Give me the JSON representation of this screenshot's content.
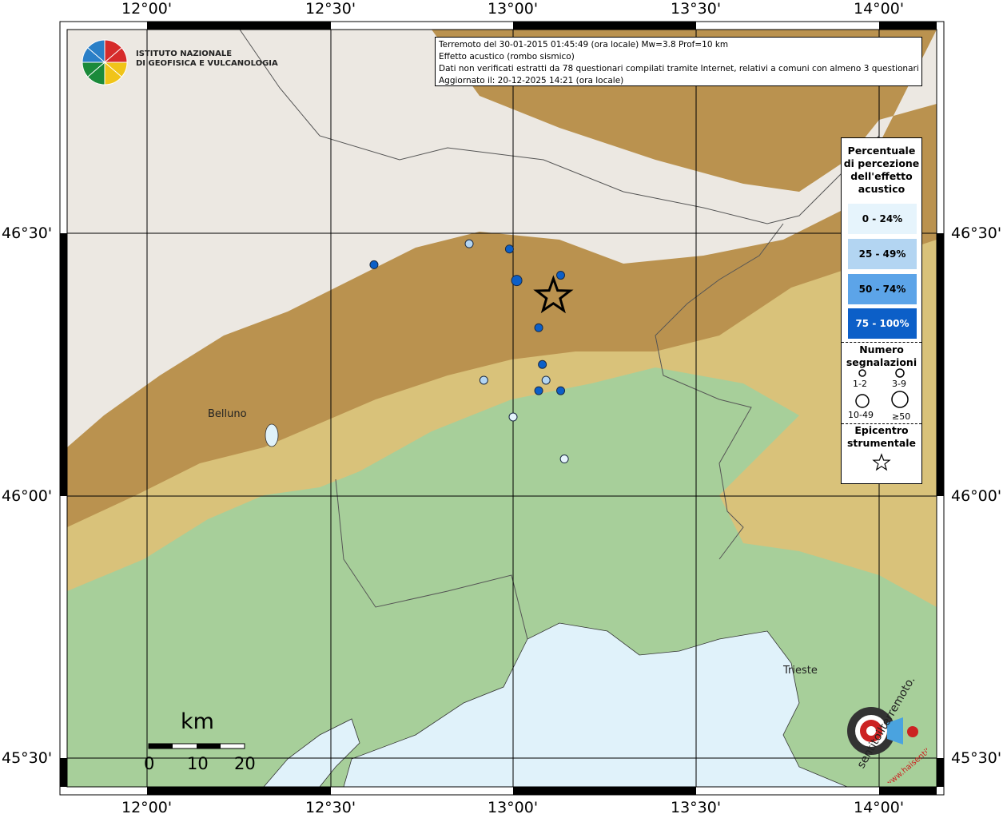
{
  "header": {
    "line1": "Terremoto del 30-01-2015 01:45:49 (ora locale) Mw=3.8 Prof=10 km",
    "line2": "Effetto acustico (rombo sismico)",
    "line3": "Dati non verificati estratti da 78 questionari compilati tramite Internet, relativi a comuni con almeno 3 questionari.",
    "line4": "Aggiornato il: 20-12-2025 14:21 (ora locale)"
  },
  "logo": {
    "line1": "ISTITUTO NAZIONALE",
    "line2": "DI GEOFISICA E VULCANOLOGIA"
  },
  "axes": {
    "top": [
      "12°00'",
      "12°30'",
      "13°00'",
      "13°30'",
      "14°00'"
    ],
    "bottom": [
      "12°00'",
      "12°30'",
      "13°00'",
      "13°30'",
      "14°00'"
    ],
    "left": [
      "46°30'",
      "46°00'",
      "45°30'"
    ],
    "right": [
      "46°30'",
      "46°00'",
      "45°30'"
    ]
  },
  "legend": {
    "title_l1": "Percentuale",
    "title_l2": "di percezione",
    "title_l3": "dell'effetto",
    "title_l4": "acustico",
    "classes": [
      {
        "label": "0 - 24%",
        "color": "#e6f4fc",
        "text_color": "#000000"
      },
      {
        "label": "25 - 49%",
        "color": "#b3d5f2",
        "text_color": "#000000"
      },
      {
        "label": "50 - 74%",
        "color": "#5ca4e8",
        "text_color": "#000000"
      },
      {
        "label": "75 - 100%",
        "color": "#0c5fc8",
        "text_color": "#ffffff"
      }
    ],
    "count_title_l1": "Numero",
    "count_title_l2": "segnalazioni",
    "sizes": [
      "1-2",
      "3-9",
      "10-49",
      "≥50"
    ],
    "epi_l1": "Epicentro",
    "epi_l2": "strumentale"
  },
  "places": {
    "belluno": "Belluno",
    "trieste": "Trieste"
  },
  "scale_bar": {
    "unit": "km",
    "ticks": [
      "0",
      "10",
      "20"
    ]
  },
  "watermark": {
    "text": "sentitoilterremoto.it",
    "url": "www.haisentito"
  },
  "colors": {
    "sea": "#e0f2fa",
    "plain": "#a7cf9a",
    "hills": "#d9c27a",
    "mountains": "#b48a48",
    "peaks": "#f2f2f2",
    "frame": "#000000"
  },
  "observations": [
    {
      "lon": 12.62,
      "lat": 46.44,
      "class": 3,
      "size": 1
    },
    {
      "lon": 12.88,
      "lat": 46.48,
      "class": 1,
      "size": 1
    },
    {
      "lon": 12.99,
      "lat": 46.47,
      "class": 3,
      "size": 1
    },
    {
      "lon": 13.01,
      "lat": 46.41,
      "class": 3,
      "size": 2
    },
    {
      "lon": 13.07,
      "lat": 46.32,
      "class": 3,
      "size": 1
    },
    {
      "lon": 13.08,
      "lat": 46.25,
      "class": 3,
      "size": 1
    },
    {
      "lon": 12.92,
      "lat": 46.22,
      "class": 1,
      "size": 1
    },
    {
      "lon": 13.09,
      "lat": 46.22,
      "class": 1,
      "size": 1
    },
    {
      "lon": 13.07,
      "lat": 46.2,
      "class": 3,
      "size": 1
    },
    {
      "lon": 13.13,
      "lat": 46.2,
      "class": 3,
      "size": 1
    },
    {
      "lon": 13.0,
      "lat": 46.15,
      "class": 0,
      "size": 1
    },
    {
      "lon": 13.14,
      "lat": 46.07,
      "class": 0,
      "size": 1
    },
    {
      "lon": 13.13,
      "lat": 46.42,
      "class": 3,
      "size": 1
    }
  ],
  "epicenter": {
    "lon": 13.11,
    "lat": 46.38
  }
}
